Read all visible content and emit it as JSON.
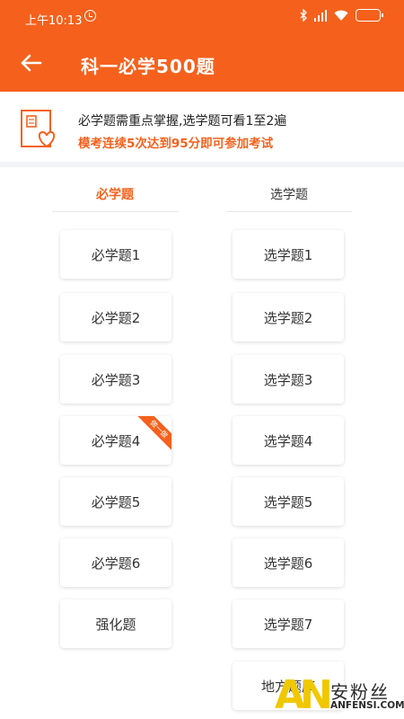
{
  "status_bar": {
    "time": "上午10:13",
    "icons": [
      "alarm-icon",
      "bluetooth-icon",
      "signal-icon",
      "wifi-icon",
      "battery-icon"
    ],
    "battery_color": "#7ee05a"
  },
  "header": {
    "title": "科一必学500题",
    "back_icon": "arrow-left-icon",
    "background": "#f5611c"
  },
  "notice": {
    "line1": "必学题需重点掌握,选学题可看1至2遍",
    "line2": "模考连续5次达到95分即可参加考试",
    "icon": "book-heart-icon"
  },
  "tabs": {
    "required": "必学题",
    "optional": "选学题",
    "active": "required",
    "accent": "#f5611c"
  },
  "required_items": [
    {
      "label": "必学题1"
    },
    {
      "label": "必学题2"
    },
    {
      "label": "必学题3"
    },
    {
      "label": "必学题4",
      "ribbon": "做一做"
    },
    {
      "label": "必学题5"
    },
    {
      "label": "必学题6"
    },
    {
      "label": "强化题"
    }
  ],
  "optional_items": [
    {
      "label": "选学题1"
    },
    {
      "label": "选学题2"
    },
    {
      "label": "选学题3"
    },
    {
      "label": "选学题4"
    },
    {
      "label": "选学题5"
    },
    {
      "label": "选学题6"
    },
    {
      "label": "选学题7"
    },
    {
      "label": "地方题库"
    }
  ],
  "watermark": {
    "logo": "AN",
    "cn": "安粉丝",
    "en": "ANFENSI.COM"
  }
}
